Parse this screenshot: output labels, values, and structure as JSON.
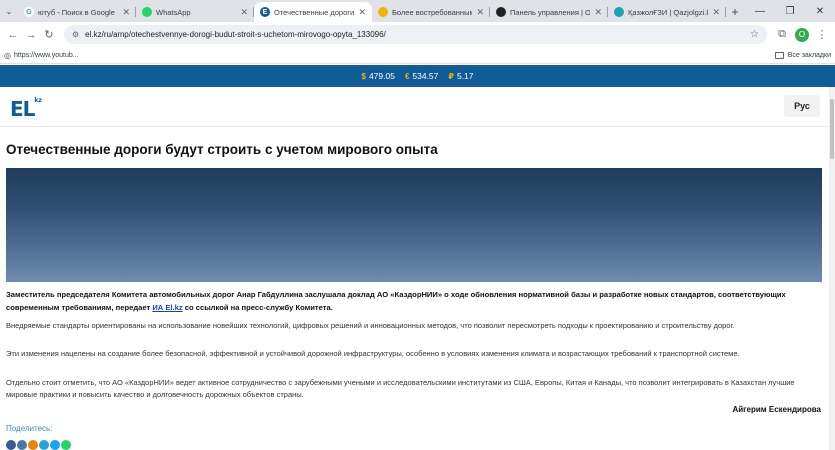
{
  "tabs": [
    {
      "title": "ютуб - Поиск в Google",
      "favicon": "google-favicon",
      "color": "#ffffff",
      "letter": "G",
      "active": false
    },
    {
      "title": "WhatsApp",
      "favicon": "whatsapp-favicon",
      "color": "#25d366",
      "letter": "",
      "active": false
    },
    {
      "title": "Отечественные дороги б",
      "favicon": "el-favicon",
      "color": "#0f5c98",
      "letter": "E",
      "active": true
    },
    {
      "title": "Более востребованными",
      "favicon": "site-favicon",
      "color": "#f0b400",
      "letter": "",
      "active": false
    },
    {
      "title": "Панель управления | Ост",
      "favicon": "panel-favicon",
      "color": "#222222",
      "letter": "",
      "active": false
    },
    {
      "title": "ҚазжолҒЗИ | Qazjolgzi.kz",
      "favicon": "qazjol-favicon",
      "color": "#1aa1b8",
      "letter": "",
      "active": false
    }
  ],
  "toolbar": {
    "url": "el.kz/ru/amp/otechestvennye-dorogi-budut-stroit-s-uchetom-mirovogo-opyta_133096/",
    "profile_letter": "O"
  },
  "bookmarks": {
    "left_item": "https://www.youtub...",
    "right_item": "Все закладки"
  },
  "currency": [
    {
      "symbol": "$",
      "value": "479.05"
    },
    {
      "symbol": "€",
      "value": "534.57"
    },
    {
      "symbol": "₽",
      "value": "5.17"
    }
  ],
  "site": {
    "logo": "EL",
    "logo_suffix": "kz",
    "lang_button": "Рус"
  },
  "article": {
    "headline": "Отечественные дороги будут строить с учетом мирового опыта",
    "lead_before": "Заместитель председателя Комитета автомобильных дорог Анар Габдуллина заслушала доклад АО «КаздорНИИ» о ходе обновления нормативной базы и разработке новых стандартов, соответствующих современным требованиям, передает ",
    "lead_link": "ИА El.kz",
    "lead_after": " со ссылкой на пресс-службу Комитета.",
    "paragraphs": [
      "Внедряемые стандарты ориентированы на использование новейших технологий, цифровых решений и инновационных методов, что позволит пересмотреть подходы к проектированию и строительству дорог.",
      "Эти изменения нацелены на создание более безопасной, эффективной и устойчивой дорожной инфраструктуры, особенно в условиях изменения климата и возрастающих требований к транспортной системе.",
      "Отдельно стоит отметить, что АО «КаздорНИИ» ведет активное сотрудничество с зарубежными учеными и исследовательскими институтами из США, Европы, Китая и Канады, что позволит интегрировать в Казахстан лучшие мировые практики и повысить качество и долговечность дорожных объектов страны."
    ],
    "author": "Айгерим Ескендирова",
    "share_label": "Поделитесь:"
  },
  "share_icons": [
    {
      "name": "facebook-icon",
      "color": "#3b5998"
    },
    {
      "name": "vk-icon",
      "color": "#4a76a8"
    },
    {
      "name": "odnoklassniki-icon",
      "color": "#ee8208"
    },
    {
      "name": "telegram-icon",
      "color": "#2aa3d6"
    },
    {
      "name": "twitter-icon",
      "color": "#1da1f2"
    },
    {
      "name": "whatsapp-icon",
      "color": "#25d366"
    }
  ]
}
